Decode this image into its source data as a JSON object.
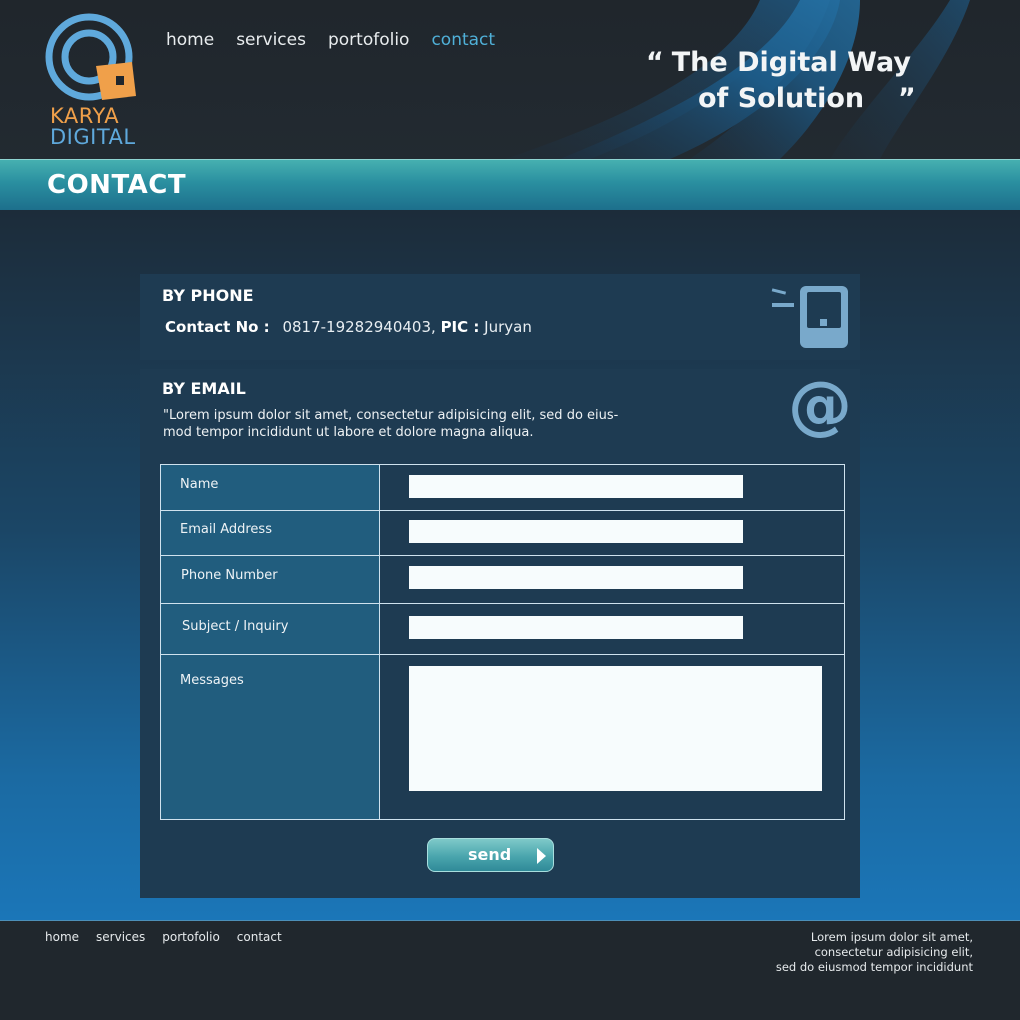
{
  "brand": {
    "line1": "KARYA",
    "line2": "DIGITAL",
    "colors": {
      "orange": "#f0a04a",
      "blue": "#5fa9dc"
    }
  },
  "nav": {
    "items": [
      {
        "label": "home"
      },
      {
        "label": "services"
      },
      {
        "label": "portofolio"
      },
      {
        "label": "contact"
      }
    ],
    "active": "contact"
  },
  "tagline": {
    "open_quote": "“",
    "line1": "The Digital Way",
    "line2": "of Solution",
    "close_quote": "”"
  },
  "page_title": "CONTACT",
  "phone": {
    "heading": "BY PHONE",
    "contact_label": "Contact No :",
    "contact_number": "0817-19282940403,",
    "pic_label": "PIC :",
    "pic_name": "Juryan",
    "icon": "mobile-phone-icon"
  },
  "email": {
    "heading": "BY EMAIL",
    "description_line1": "\"Lorem ipsum dolor sit amet, consectetur adipisicing elit, sed do eius-",
    "description_line2": "mod tempor incididunt ut labore et dolore magna aliqua.",
    "icon": "at-sign-icon",
    "icon_glyph": "@"
  },
  "form": {
    "fields": [
      {
        "label": "Name",
        "value": ""
      },
      {
        "label": "Email Address",
        "value": ""
      },
      {
        "label": "Phone Number",
        "value": ""
      },
      {
        "label": "Subject / Inquiry",
        "value": ""
      },
      {
        "label": "Messages",
        "value": ""
      }
    ],
    "send_label": "send"
  },
  "footer": {
    "nav": [
      {
        "label": "home"
      },
      {
        "label": "services"
      },
      {
        "label": "portofolio"
      },
      {
        "label": "contact"
      }
    ],
    "text_line1": "Lorem ipsum dolor sit amet,",
    "text_line2": "consectetur adipisicing elit,",
    "text_line3": "sed do eiusmod tempor incididunt"
  }
}
